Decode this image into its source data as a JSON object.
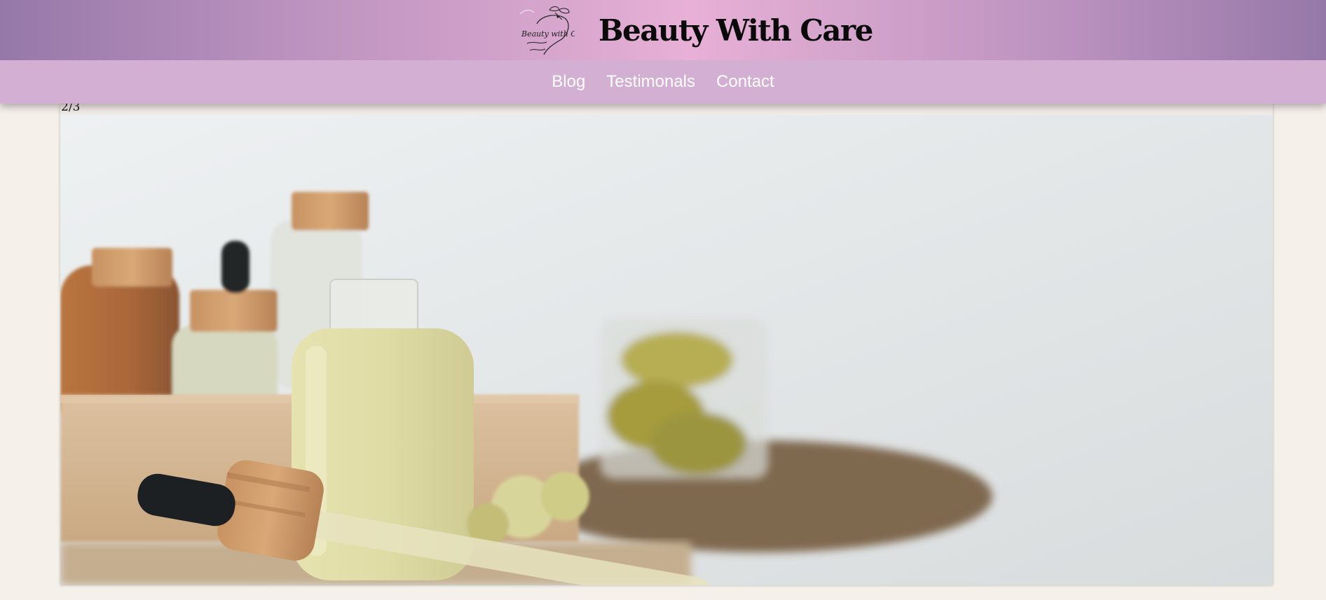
{
  "header": {
    "logo_text": "Beauty with Care",
    "title": "Beauty With Care"
  },
  "nav": {
    "items": [
      {
        "label": "Blog"
      },
      {
        "label": "Testimonals"
      },
      {
        "label": "Contact"
      }
    ]
  },
  "slideshow": {
    "counter": "2/3",
    "image_subject": "cosmetic oil bottles with dropper, wooden box and dried flowers"
  },
  "colors": {
    "page_background": "#f5f1ea",
    "header_gradient_edge": "#9678a8",
    "header_gradient_center": "#e8b0d6",
    "nav_background": "#d3afd3",
    "nav_text": "#ffffff",
    "title_text": "#0a0a0a"
  }
}
